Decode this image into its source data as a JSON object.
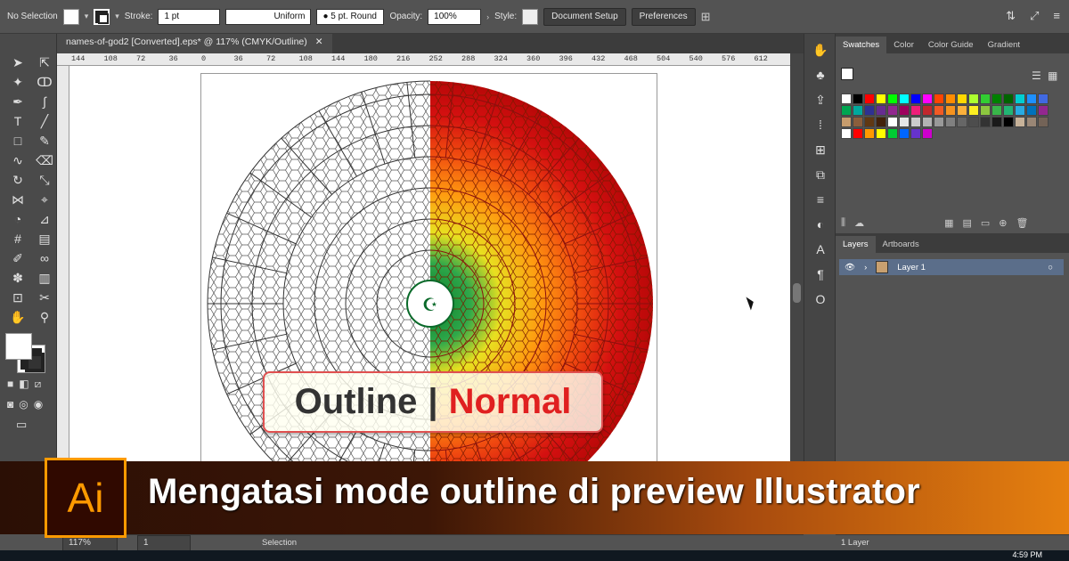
{
  "control_bar": {
    "selection": "No Selection",
    "stroke_label": "Stroke:",
    "stroke_weight": "1 pt",
    "stroke_profile": "Uniform",
    "brush": "5 pt. Round",
    "opacity_label": "Opacity:",
    "opacity_value": "100%",
    "style_label": "Style:",
    "document_setup": "Document Setup",
    "preferences": "Preferences"
  },
  "document": {
    "tab_title": "names-of-god2 [Converted].eps* @ 117% (CMYK/Outline)",
    "ruler_ticks": [
      "144",
      "108",
      "72",
      "36",
      "0",
      "36",
      "72",
      "108",
      "144",
      "180",
      "216",
      "252",
      "288",
      "324",
      "360",
      "396",
      "432",
      "468",
      "504",
      "540",
      "576",
      "612"
    ]
  },
  "overlay": {
    "outline": "Outline",
    "separator": "|",
    "normal": "Normal"
  },
  "banner": {
    "logo_text": "Ai",
    "title": "Mengatasi mode outline di preview Illustrator"
  },
  "panels": {
    "swatches_tabs": [
      "Swatches",
      "Color",
      "Color Guide",
      "Gradient"
    ],
    "layers_tabs": [
      "Layers",
      "Artboards"
    ],
    "layer_name": "Layer 1",
    "layers_count": "1 Layer",
    "swatch_colors": [
      "#ffffff",
      "#000000",
      "#ff0000",
      "#ffff00",
      "#00ff00",
      "#00ffff",
      "#0000ff",
      "#ff00ff",
      "#ff4500",
      "#ff8c00",
      "#ffd700",
      "#adff2f",
      "#32cd32",
      "#008000",
      "#006400",
      "#00ced1",
      "#1e90ff",
      "#4169e1",
      "#00a651",
      "#00a99d",
      "#2e3192",
      "#662d91",
      "#92278f",
      "#9e005d",
      "#ed1e79",
      "#c1272d",
      "#f15a24",
      "#f7931e",
      "#fbb03b",
      "#fcee21",
      "#8cc63f",
      "#39b54a",
      "#22b573",
      "#29abe2",
      "#0071bc",
      "#93278f",
      "#c69c6d",
      "#8b5e3c",
      "#603813",
      "#42210b",
      "#ffffff",
      "#e6e6e6",
      "#cccccc",
      "#b3b3b3",
      "#999999",
      "#808080",
      "#666666",
      "#4d4d4d",
      "#333333",
      "#1a1a1a",
      "#000000",
      "#c7b299",
      "#998675",
      "#736357",
      "#ffffff",
      "#ff0000",
      "#ff9900",
      "#ffff00",
      "#00cc33",
      "#0066ff",
      "#6633cc",
      "#cc00cc"
    ]
  },
  "status": {
    "zoom": "117%",
    "artboard": "1",
    "mode": "Selection",
    "time": "4:59 PM"
  }
}
